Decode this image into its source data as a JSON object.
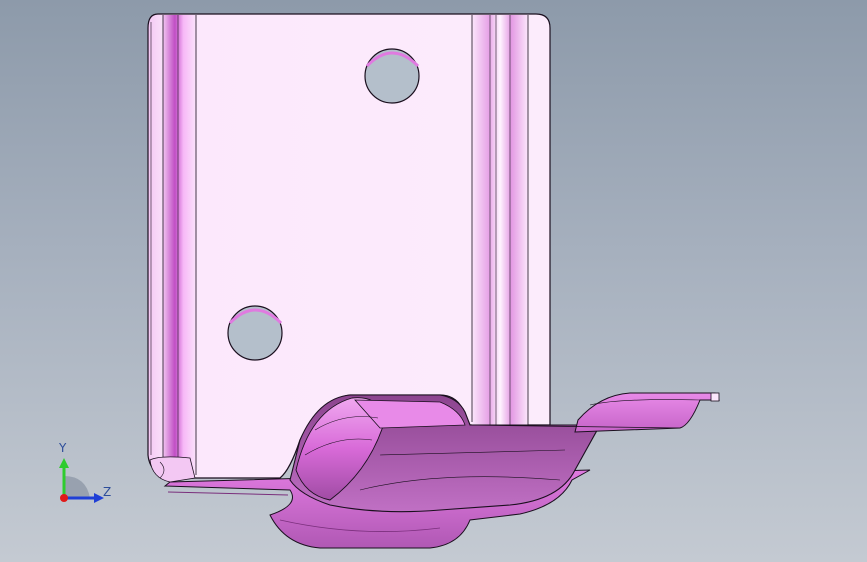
{
  "viewport": {
    "background_top": "#8d9aaa",
    "background_bottom": "#c4cad2"
  },
  "part": {
    "face_color": "#fbe6fb",
    "edge_color": "#1a0f1e",
    "accent_color": "#e07ae0",
    "shadow_color": "#9a4f9a",
    "hole_color": "#b4bfcb"
  },
  "triad": {
    "y_label": "Y",
    "z_label": "Z",
    "y_color": "#2ecc2e",
    "z_color": "#1f3fd6",
    "origin_color": "#e01919"
  }
}
